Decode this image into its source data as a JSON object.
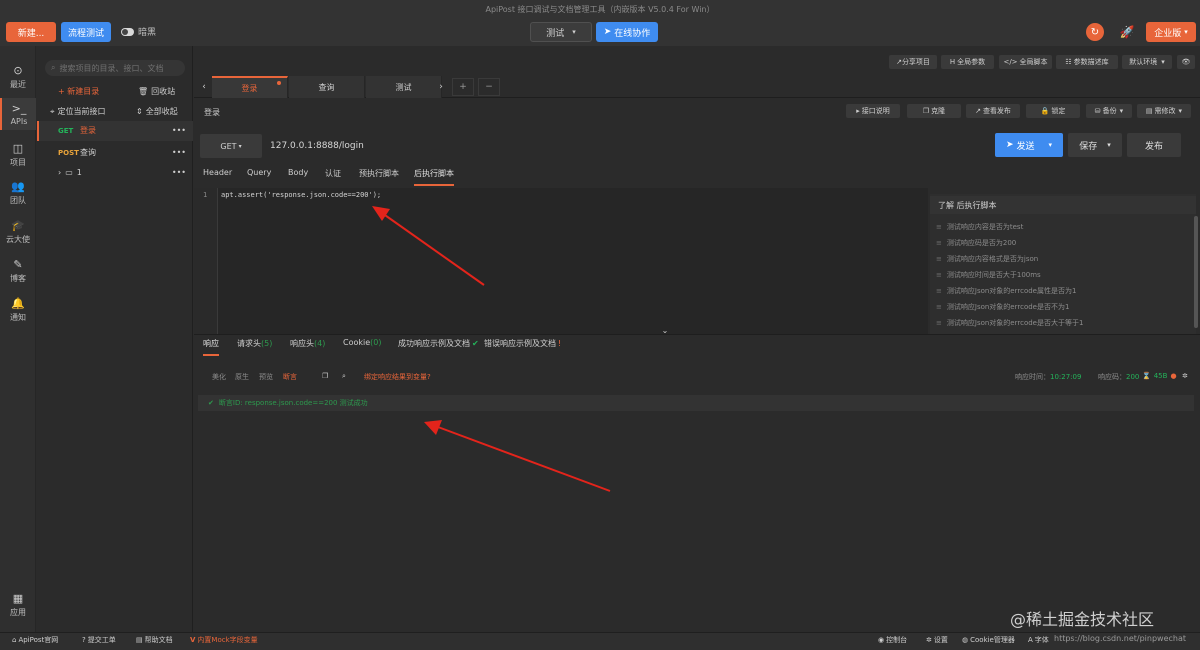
{
  "app": {
    "title": "ApiPost 接口调试与文档管理工具（内嵌版本 V5.0.4 For Win）",
    "new_btn": "新建...",
    "flow_btn": "流程测试",
    "dark_label": "暗黑",
    "env": "测试",
    "collab_btn": "在线协作",
    "enterprise_btn": "企业版"
  },
  "rail": [
    {
      "icon": "clock-icon",
      "glyph": "⊙",
      "label": "最近"
    },
    {
      "icon": "terminal-icon",
      "glyph": ">_",
      "label": "APIs"
    },
    {
      "icon": "project-icon",
      "glyph": "◫",
      "label": "项目"
    },
    {
      "icon": "team-icon",
      "glyph": "👥",
      "label": "团队"
    },
    {
      "icon": "cap-icon",
      "glyph": "🎓",
      "label": "云大使"
    },
    {
      "icon": "edit-icon",
      "glyph": "✎",
      "label": "博客"
    },
    {
      "icon": "bell-icon",
      "glyph": "🔔",
      "label": "通知"
    },
    {
      "icon": "apps-icon",
      "glyph": "▦",
      "label": "应用"
    }
  ],
  "tree": {
    "search_placeholder": "搜索项目的目录、接口、文档",
    "new_dir": "+ 新建目录",
    "recycle": "回收站",
    "locate": "定位当前接口",
    "collapse_all": "全部收起",
    "items": [
      {
        "method": "GET",
        "name": "登录"
      },
      {
        "method": "POST",
        "name": "查询"
      },
      {
        "folder": "1"
      }
    ]
  },
  "top_tools": {
    "share": "分享项目",
    "global_params": "全局参数",
    "global_script": "全局脚本",
    "param_lib": "参数描述库",
    "default_env": "默认环境"
  },
  "tabs": [
    {
      "label": "登录"
    },
    {
      "label": "查询"
    },
    {
      "label": "测试"
    }
  ],
  "breadcrumb": "登录",
  "req_tools": {
    "doc": "接口说明",
    "clone": "克隆",
    "view_publish": "查看发布",
    "lock": "锁定",
    "backup": "备份",
    "change_log": "需修改"
  },
  "request": {
    "method": "GET",
    "url": "127.0.0.1:8888/login",
    "send": "发送",
    "save": "保存",
    "publish": "发布"
  },
  "subtabs": [
    "Header",
    "Query",
    "Body",
    "认证",
    "预执行脚本",
    "后执行脚本"
  ],
  "editor": {
    "line_no": "1",
    "code": "apt.assert('response.json.code==200');"
  },
  "snippets": {
    "title": "了解 后执行脚本",
    "items": [
      "测试响应内容是否为test",
      "测试响应码是否为200",
      "测试响应内容格式是否为json",
      "测试响应时间是否大于100ms",
      "测试响应Json对象的errcode属性是否为1",
      "测试响应Json对象的errcode是否不为1",
      "测试响应Json对象的errcode是否大于等于1"
    ]
  },
  "response_tabs": [
    {
      "label": "响应",
      "count": ""
    },
    {
      "label": "请求头",
      "count": "(5)"
    },
    {
      "label": "响应头",
      "count": "(4)"
    },
    {
      "label": "Cookie",
      "count": "(0)"
    },
    {
      "label": "成功响应示例及文档",
      "count": ""
    },
    {
      "label": "错误响应示例及文档",
      "count": ""
    }
  ],
  "response": {
    "formats": [
      "美化",
      "原生",
      "预览",
      "断言"
    ],
    "bind_var": "绑定响应结果到变量?",
    "time_label": "响应时间：",
    "time_value": "10:27:09",
    "code_label": "响应码：",
    "code_value": "200",
    "size_value": "45B",
    "assert_result": "断言ID: response.json.code==200 测试成功"
  },
  "status": {
    "site": "ApiPost官网",
    "ticket": "提交工单",
    "help": "帮助文档",
    "mock": "内置Mock字段变量",
    "console": "控制台",
    "settings": "设置",
    "cookies": "Cookie管理器",
    "font": "字体"
  },
  "watermark": "@稀土掘金技术社区",
  "watermark_url": "https://blog.csdn.net/pinpwechat",
  "colors": {
    "accent": "#e8653a",
    "primary": "#3f8cf0",
    "success": "#24b35a"
  }
}
